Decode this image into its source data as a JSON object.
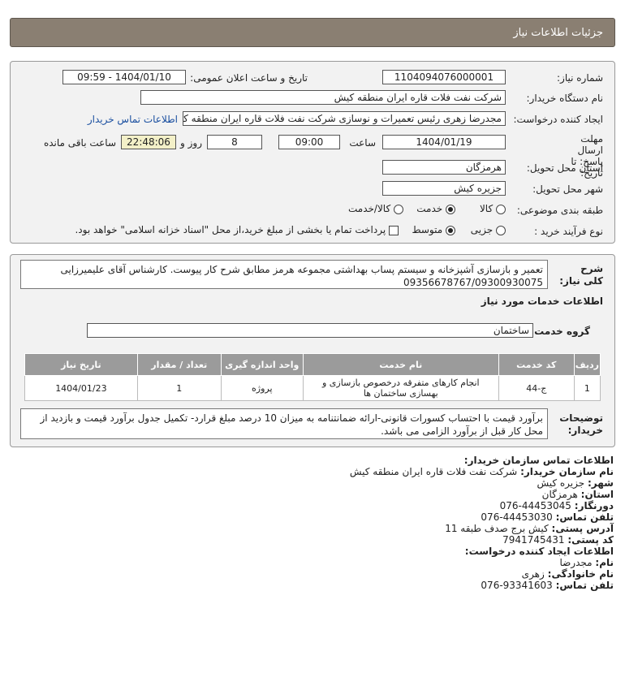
{
  "page_title": "جزئیات اطلاعات نیاز",
  "labels": {
    "need_number": "شماره نیاز:",
    "announce_datetime": "تاریخ و ساعت اعلان عمومی:",
    "buyer_org": "نام دستگاه خریدار:",
    "request_creator": "ایجاد کننده درخواست:",
    "buyer_contact_link": "اطلاعات تماس خریدار",
    "deadline": "مهلت ارسال پاسخ: تا تاریخ:",
    "hour": "ساعت",
    "days_and": "روز و",
    "remaining": "ساعت باقی مانده",
    "province": "استان محل تحویل:",
    "city": "شهر محل تحویل:",
    "category": "طبقه بندی موضوعی:",
    "process_type": "نوع فرآیند خرید :",
    "general_desc": "شرح کلی نیاز:",
    "services_header": "اطلاعات خدمات مورد نیاز",
    "service_group": "گروه خدمت:",
    "buyer_notes": "توضیحات خریدار:"
  },
  "fields": {
    "need_number": "1104094076000001",
    "announce_datetime": "1404/01/10 - 09:59",
    "buyer_org": "شرکت نفت فلات قاره ایران منطقه کیش",
    "request_creator": "مجدرضا  زهری رئیس تعمیرات و نوسازی  شرکت نفت فلات قاره ایران منطقه کیش",
    "deadline_date": "1404/01/19",
    "deadline_time": "09:00",
    "days_left": "8",
    "time_left": "22:48:06",
    "province": "هرمزگان",
    "city": "جزیره کیش",
    "service_group": "ساختمان"
  },
  "category_options": [
    "کالا",
    "خدمت",
    "کالا/خدمت"
  ],
  "category_selected": "خدمت",
  "process_options": [
    "جزیی",
    "متوسط"
  ],
  "process_selected": "متوسط",
  "treasury_note": "پرداخت تمام یا بخشی از مبلغ خرید،از محل \"اسناد خزانه اسلامی\" خواهد بود.",
  "general_desc": "تعمیر و بازسازی آشپزخانه و سیستم پساب بهداشتی مجموعه هرمز مطابق شرح کار پیوست. کارشناس آقای علیمیرزایی 09356678767/09300930075",
  "table": {
    "headers": [
      "ردیف",
      "کد خدمت",
      "نام خدمت",
      "واحد اندازه گیری",
      "تعداد / مقدار",
      "تاریخ نیاز"
    ],
    "rows": [
      [
        "1",
        "ج-44",
        "انجام کارهای متفرقه درخصوص بازسازی و بهسازی ساختمان ها",
        "پروژه",
        "1",
        "1404/01/23"
      ]
    ]
  },
  "buyer_notes": "برآورد قیمت با احتساب کسورات قانونی-ارائه ضمانتنامه به میزان 10 درصد مبلغ قرارد- تکمیل جدول برآورد قیمت و بازدید از محل کار قبل از برآورد الزامی می باشد.",
  "contact": {
    "header": "اطلاعات تماس سازمان خریدار:",
    "org_label": "نام سازمان خریدار:",
    "org": "شرکت نفت فلات قاره ایران منطقه کیش",
    "city_label": "شهر:",
    "city": "جزیره کیش",
    "province_label": "استان:",
    "province": "هرمزگان",
    "fax_label": "دورنگار:",
    "fax": "076-44453045",
    "phone_label": "تلفن تماس:",
    "phone": "076-44453030",
    "address_label": "آدرس پستی:",
    "address": "کیش برج صدف طبقه 11",
    "postal_label": "کد پستی:",
    "postal": "7941745431",
    "creator_header": "اطلاعات ایجاد کننده درخواست:",
    "name_label": "نام:",
    "name": "مجدرضا",
    "family_label": "نام خانوادگی:",
    "family": "زهری",
    "creator_phone_label": "تلفن تماس:",
    "creator_phone": "076-93341603"
  }
}
